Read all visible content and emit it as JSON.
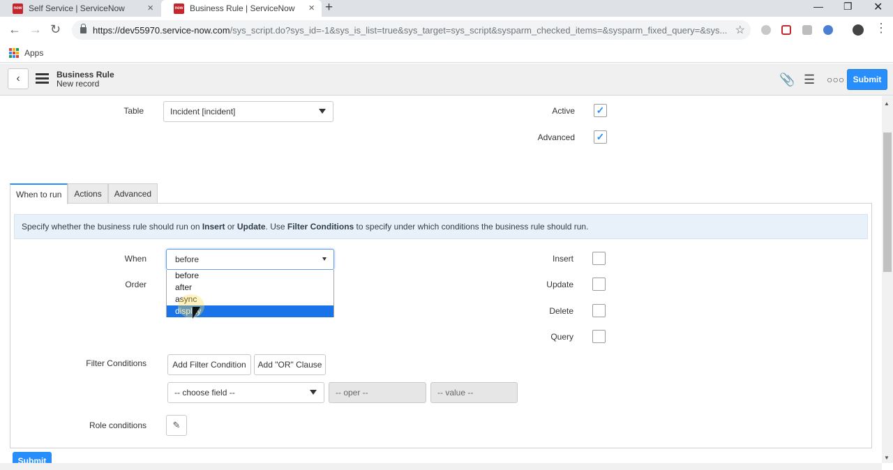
{
  "browser": {
    "tabs": [
      {
        "title": "Self Service | ServiceNow",
        "active": false
      },
      {
        "title": "Business Rule | ServiceNow",
        "active": true
      }
    ],
    "favicon_text": "now",
    "url_host": "https://dev55970.service-now.com",
    "url_path": "/sys_script.do?sys_id=-1&sys_is_list=true&sys_target=sys_script&sysparm_checked_items=&sysparm_fixed_query=&sys...",
    "bookmarks_apps": "Apps"
  },
  "header": {
    "title": "Business Rule",
    "subtitle": "New record",
    "submit_label": "Submit"
  },
  "fields": {
    "table_label": "Table",
    "table_value": "Incident [incident]",
    "active_label": "Active",
    "active_checked": true,
    "advanced_label": "Advanced",
    "advanced_checked": true
  },
  "form_tabs": [
    {
      "label": "When to run",
      "selected": true
    },
    {
      "label": "Actions",
      "selected": false
    },
    {
      "label": "Advanced",
      "selected": false
    }
  ],
  "info": {
    "p1": "Specify whether the business rule should run on ",
    "insert": "Insert",
    "p2": " or ",
    "update": "Update",
    "p3": ". Use ",
    "filter": "Filter Conditions",
    "p4": " to specify under which conditions the business rule should run."
  },
  "when": {
    "label": "When",
    "value": "before",
    "options": [
      "before",
      "after",
      "async",
      "display"
    ],
    "highlighted_index": 3
  },
  "order_label": "Order",
  "operations": {
    "insert_label": "Insert",
    "update_label": "Update",
    "delete_label": "Delete",
    "query_label": "Query"
  },
  "filter": {
    "label": "Filter Conditions",
    "add_condition": "Add Filter Condition",
    "add_or": "Add \"OR\" Clause",
    "field_placeholder": "-- choose field --",
    "oper_placeholder": "-- oper --",
    "value_placeholder": "-- value --"
  },
  "role_label": "Role conditions",
  "bottom_submit": "Submit"
}
